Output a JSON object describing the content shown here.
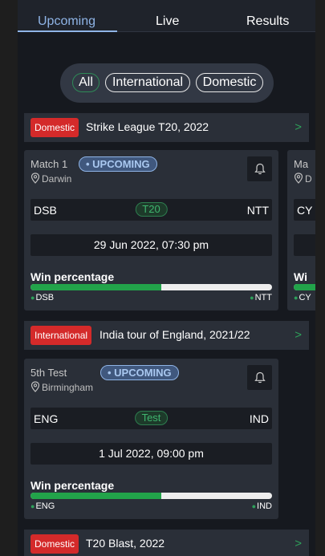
{
  "tabs": [
    {
      "label": "Upcoming",
      "active": true
    },
    {
      "label": "Live",
      "active": false
    },
    {
      "label": "Results",
      "active": false
    }
  ],
  "filters": [
    {
      "label": "All",
      "active": true
    },
    {
      "label": "International",
      "active": false
    },
    {
      "label": "Domestic",
      "active": false
    }
  ],
  "colors": {
    "accent": "#8fb4e6",
    "badge_red": "#d42a2a",
    "win_green": "#22a34a",
    "card_bg": "#2a2f38"
  },
  "sections": [
    {
      "badge": "Domestic",
      "title": "Strike League T20, 2022",
      "arrow": ">",
      "matches": [
        {
          "match_no": "Match 1",
          "status": "• UPCOMING",
          "venue": "Darwin",
          "team_a": "DSB",
          "team_b": "NTT",
          "format": "T20",
          "datetime": "29 Jun 2022, 07:30 pm",
          "win_label": "Win percentage",
          "win_pct_a": 54,
          "legend_a": "DSB",
          "legend_b": "NTT"
        },
        {
          "match_no": "Ma",
          "venue": "D",
          "team_a": "CY",
          "win_label": "Wi",
          "legend_a": "CY"
        }
      ]
    },
    {
      "badge": "International",
      "title": "India tour of England, 2021/22",
      "arrow": ">",
      "matches": [
        {
          "match_no": "5th Test",
          "status": "• UPCOMING",
          "venue": "Birmingham",
          "team_a": "ENG",
          "team_b": "IND",
          "format": "Test",
          "datetime": "1 Jul 2022, 09:00 pm",
          "win_label": "Win percentage",
          "win_pct_a": 54,
          "legend_a": "ENG",
          "legend_b": "IND"
        }
      ]
    },
    {
      "badge": "Domestic",
      "title": "T20 Blast, 2022",
      "arrow": ">"
    }
  ]
}
